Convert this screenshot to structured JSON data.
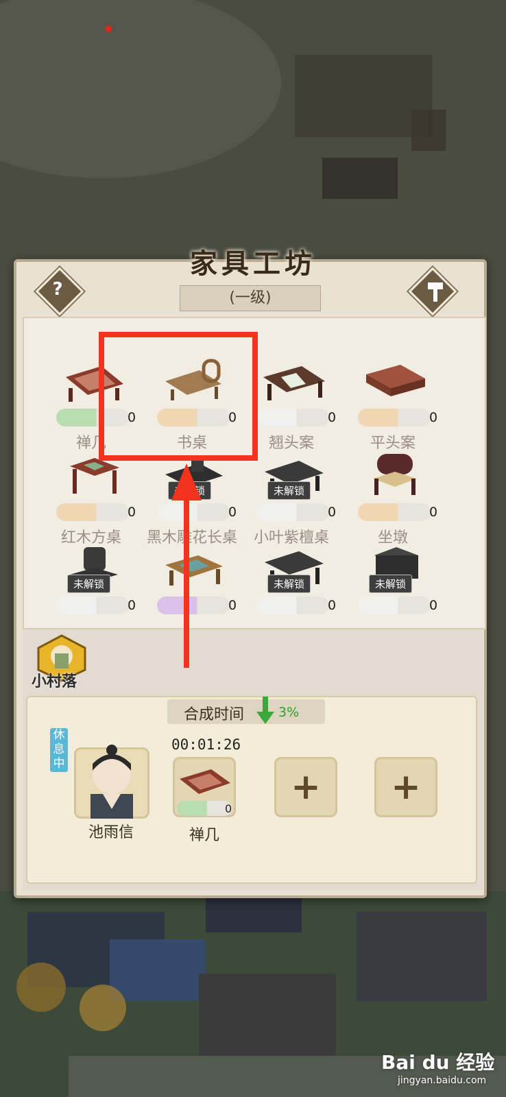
{
  "window": {
    "title": "家具工坊",
    "level": "(一级)"
  },
  "buttons": {
    "help_icon": "question-icon",
    "help_glyph": "?",
    "build_icon": "hammer-icon"
  },
  "items": [
    {
      "label": "禅几",
      "count": "0",
      "locked": false,
      "bar_color": "#b9dcb0"
    },
    {
      "label": "书桌",
      "count": "0",
      "locked": false,
      "bar_color": "#f0d6b3"
    },
    {
      "label": "翘头案",
      "count": "0",
      "locked": false,
      "bar_color": "#f0f0ee"
    },
    {
      "label": "平头案",
      "count": "0",
      "locked": false,
      "bar_color": "#f0d6b3"
    },
    {
      "label": "红木方桌",
      "count": "0",
      "locked": false,
      "bar_color": "#f0d6b3"
    },
    {
      "label": "黑木雕花长桌",
      "count": "0",
      "locked": true,
      "lock_text": "未解锁",
      "bar_color": "#f0f0ee"
    },
    {
      "label": "小叶紫檀桌",
      "count": "0",
      "locked": true,
      "lock_text": "未解锁",
      "bar_color": "#f0f0ee"
    },
    {
      "label": "坐墩",
      "count": "0",
      "locked": false,
      "bar_color": "#f0d6b3"
    },
    {
      "label": "",
      "count": "0",
      "locked": true,
      "lock_text": "未解锁",
      "bar_color": "#f0f0ee"
    },
    {
      "label": "",
      "count": "0",
      "locked": false,
      "bar_color": "#dcc0ec"
    },
    {
      "label": "",
      "count": "0",
      "locked": true,
      "lock_text": "未解锁",
      "bar_color": "#f0f0ee"
    },
    {
      "label": "",
      "count": "0",
      "locked": true,
      "lock_text": "未解锁",
      "bar_color": "#f0f0ee"
    }
  ],
  "village": {
    "label": "小村落"
  },
  "crafting": {
    "time_label": "合成时间",
    "bonus_pct": "3%",
    "worker_name": "池雨信",
    "worker_status": "休息中",
    "timer": "00:01:26",
    "current_item": "禅几",
    "current_count": "0",
    "add_slot_glyph": "+"
  },
  "watermark": {
    "brand": "Bai du 经验",
    "url": "jingyan.baidu.com"
  },
  "colors": {
    "highlight": "#f2341e",
    "panel": "#e9e2d2",
    "accent_green": "#2aa02a"
  }
}
